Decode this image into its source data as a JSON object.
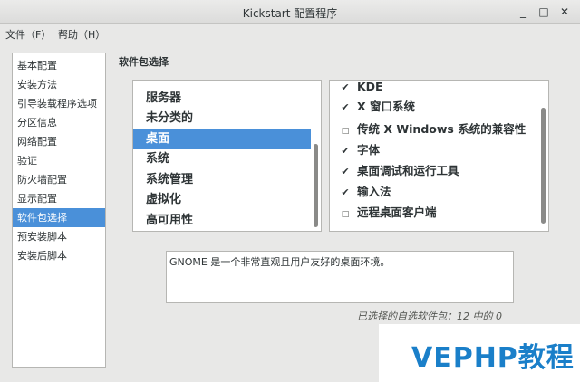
{
  "window": {
    "title": "Kickstart 配置程序",
    "controls": {
      "minimize": "_",
      "maximize": "□",
      "close": "✕"
    }
  },
  "menubar": [
    {
      "label": "文件（F）"
    },
    {
      "label": "帮助（H）"
    }
  ],
  "sidebar": {
    "items": [
      {
        "label": "基本配置"
      },
      {
        "label": "安装方法"
      },
      {
        "label": "引导装载程序选项"
      },
      {
        "label": "分区信息"
      },
      {
        "label": "网络配置"
      },
      {
        "label": "验证"
      },
      {
        "label": "防火墙配置"
      },
      {
        "label": "显示配置"
      },
      {
        "label": "软件包选择",
        "selected": true
      },
      {
        "label": "预安装脚本"
      },
      {
        "label": "安装后脚本"
      }
    ]
  },
  "main": {
    "section_title": "软件包选择",
    "categories": [
      {
        "label": "服务器"
      },
      {
        "label": "未分类的"
      },
      {
        "label": "桌面",
        "selected": true
      },
      {
        "label": "系统"
      },
      {
        "label": "系统管理"
      },
      {
        "label": "虚拟化"
      },
      {
        "label": "高可用性"
      }
    ],
    "packages": [
      {
        "label": "KDE",
        "checked": true
      },
      {
        "label": "X 窗口系统",
        "checked": true
      },
      {
        "label": "传统 X Windows 系统的兼容性",
        "checked": false
      },
      {
        "label": "字体",
        "checked": true
      },
      {
        "label": "桌面调试和运行工具",
        "checked": true
      },
      {
        "label": "输入法",
        "checked": true
      },
      {
        "label": "远程桌面客户端",
        "checked": false
      }
    ],
    "description": "GNOME 是一个非常直观且用户友好的桌面环境。",
    "status": "已选择的自选软件包：12 中的 0"
  },
  "watermark": {
    "text": "VEPHP教程"
  },
  "colors": {
    "selection": "#4a90d9",
    "watermark": "#1a7fc9"
  }
}
